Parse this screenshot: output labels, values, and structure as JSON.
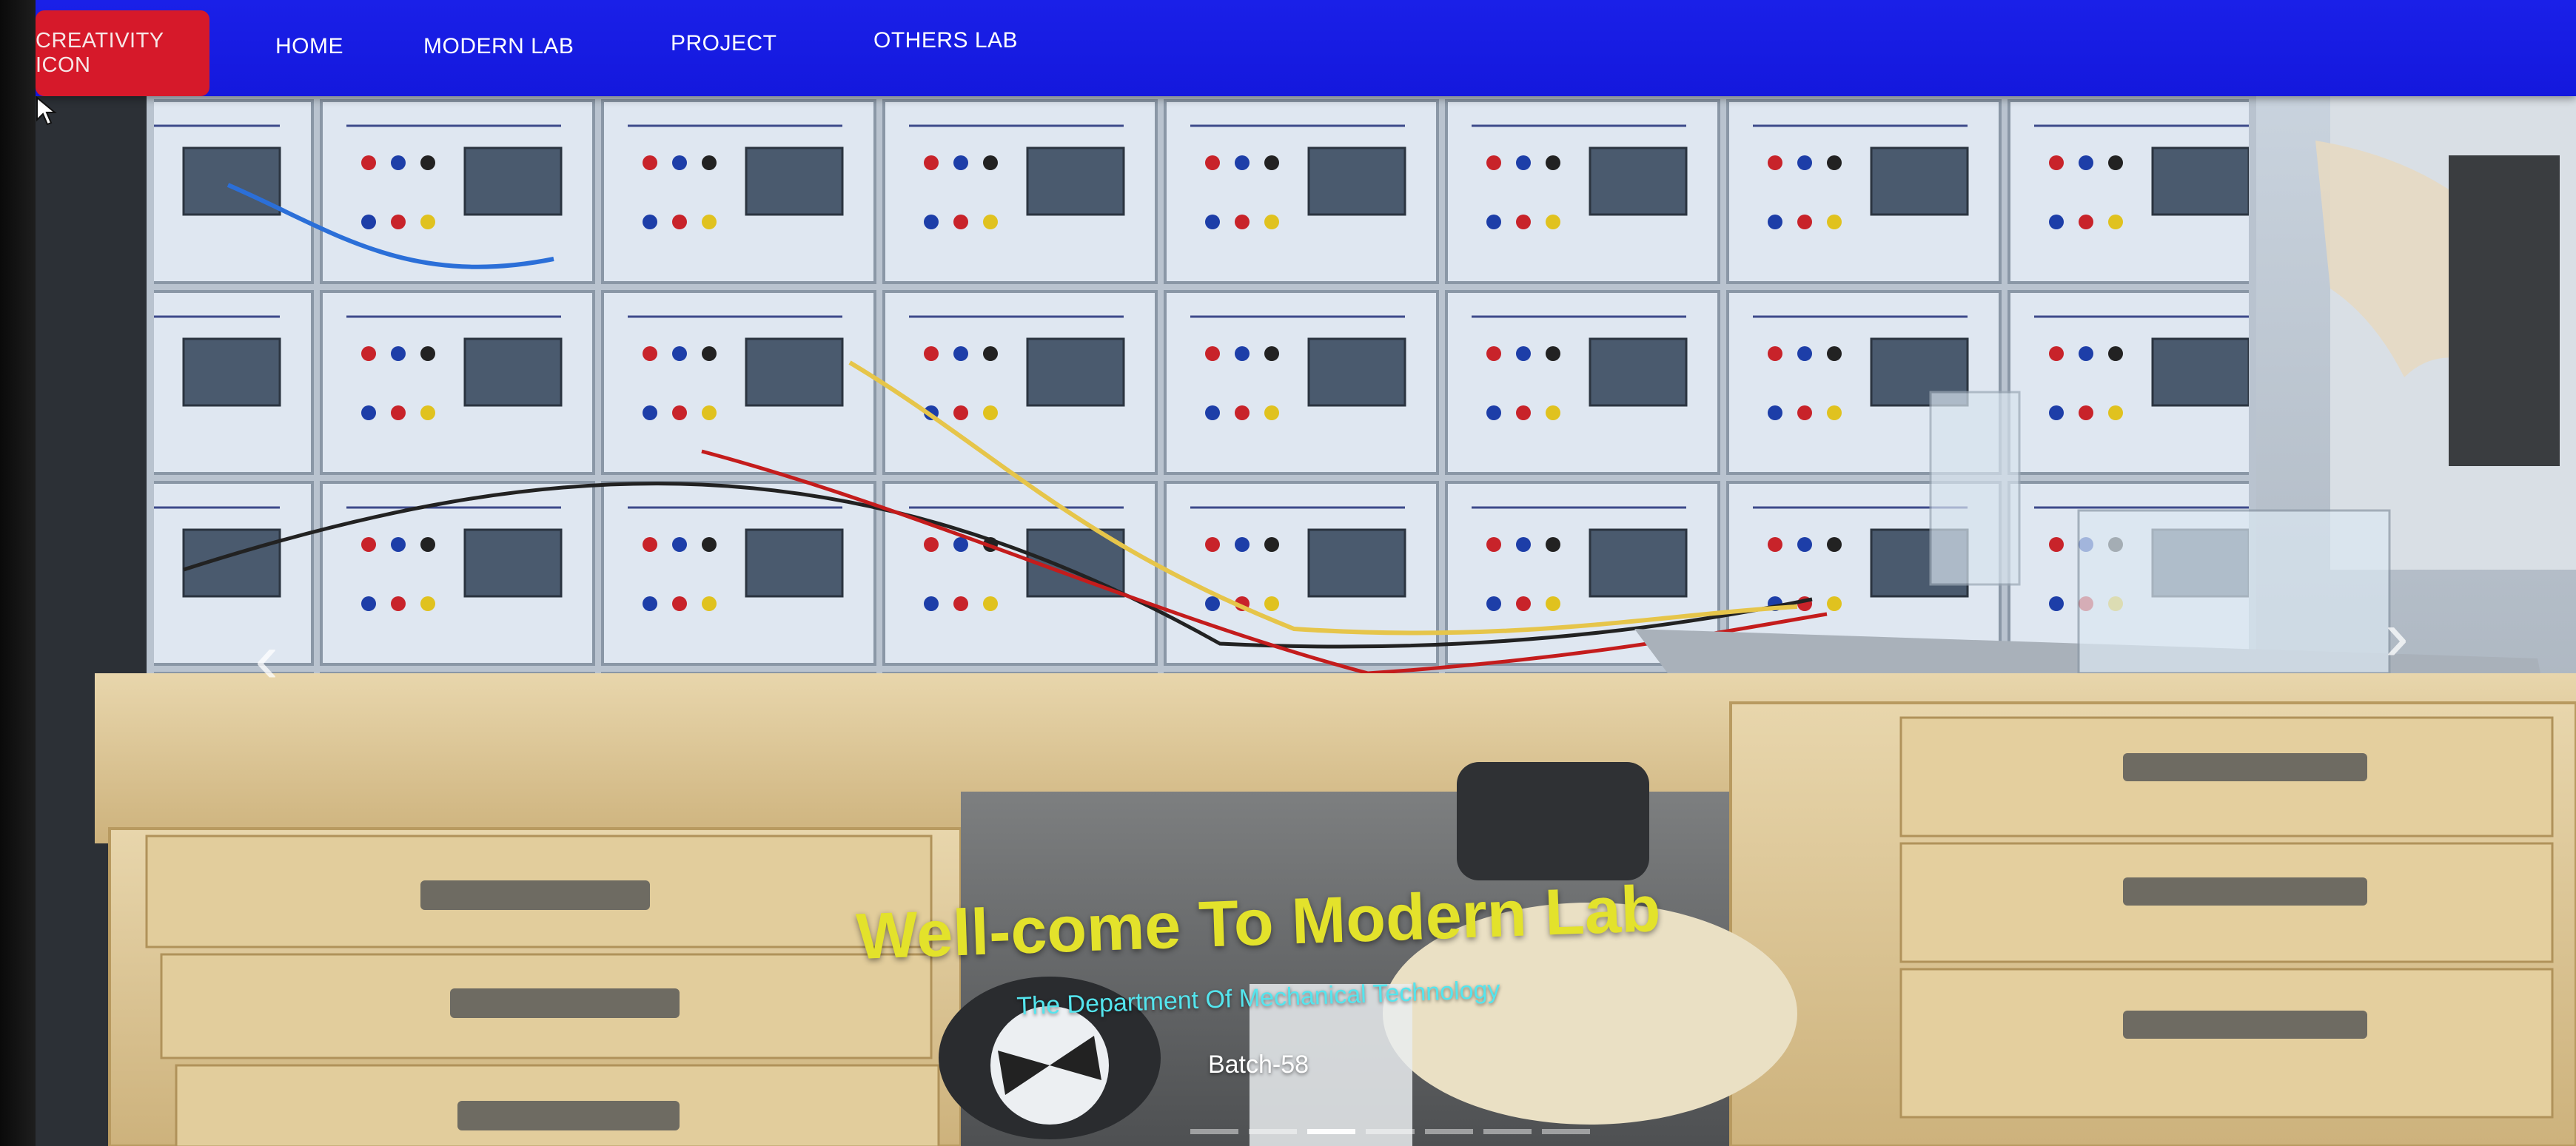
{
  "navbar": {
    "brand": "CREATIVITY ICON",
    "items": [
      {
        "label": "HOME"
      },
      {
        "label": "MODERN LAB"
      },
      {
        "label": "PROJECT"
      },
      {
        "label": "OTHERS LAB"
      }
    ],
    "color": "#1a20e8",
    "brand_color": "#d6192a"
  },
  "carousel": {
    "title": "Well-come To Modern Lab",
    "subtitle": "The Department Of Mechanical Technology",
    "batch": "Batch-58",
    "prev_icon": "chevron-left-icon",
    "next_icon": "chevron-right-icon",
    "slide_count": 7,
    "active_slide": 2,
    "title_color": "#e3e22b",
    "subtitle_color": "#54e5ee"
  }
}
